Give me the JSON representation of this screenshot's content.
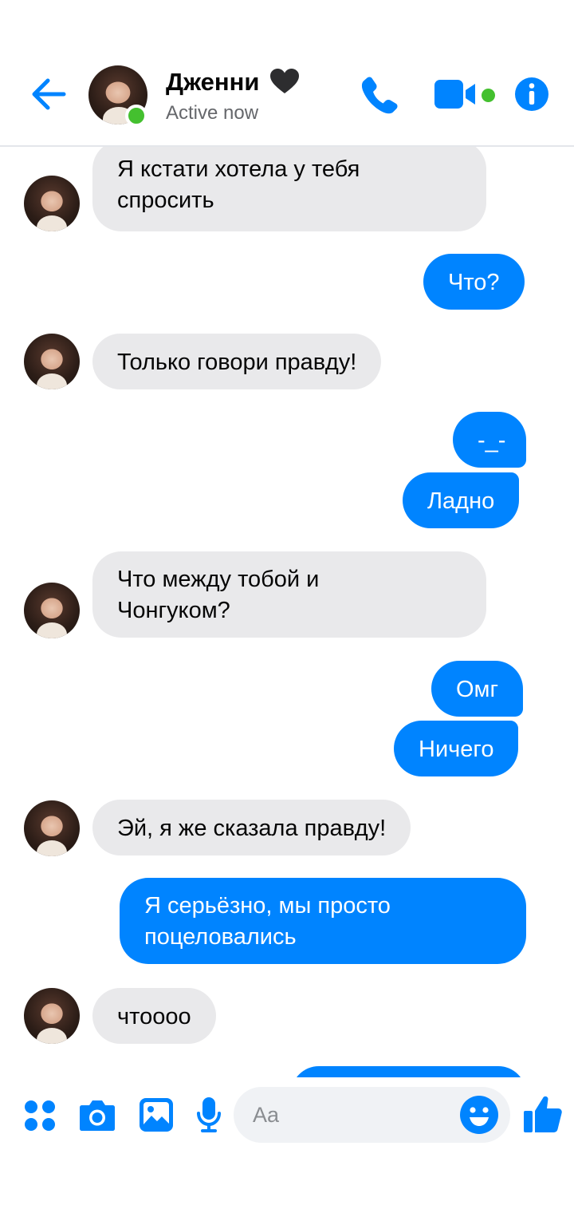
{
  "header": {
    "contact_name": "Дженни",
    "status": "Active now",
    "icons": [
      "back-arrow-icon",
      "heart-icon",
      "phone-icon",
      "video-camera-icon",
      "info-icon"
    ]
  },
  "messages": [
    {
      "side": "in",
      "text": "Я кстати хотела у тебя\nспросить"
    },
    {
      "side": "out",
      "text": "Что?"
    },
    {
      "side": "in",
      "text": "Только говори правду!"
    },
    {
      "side": "out",
      "text": "-_-"
    },
    {
      "side": "out",
      "text": "Ладно"
    },
    {
      "side": "in",
      "text": "Что между тобой и\nЧонгуком?"
    },
    {
      "side": "out",
      "text": "Омг"
    },
    {
      "side": "out",
      "text": "Ничего"
    },
    {
      "side": "in",
      "text": "Эй, я же сказала правду!"
    },
    {
      "side": "out",
      "text": "Я серьёзно, мы просто\nпоцеловались"
    },
    {
      "side": "in",
      "text": "чтоооо"
    }
  ],
  "composer": {
    "placeholder": "Aa",
    "icons": [
      "apps-icon",
      "camera-icon",
      "gallery-icon",
      "microphone-icon",
      "emoji-icon",
      "thumbs-up-icon"
    ]
  },
  "colors": {
    "accent": "#0084ff",
    "incoming_bubble": "#e9e9eb",
    "online": "#44c02f"
  }
}
